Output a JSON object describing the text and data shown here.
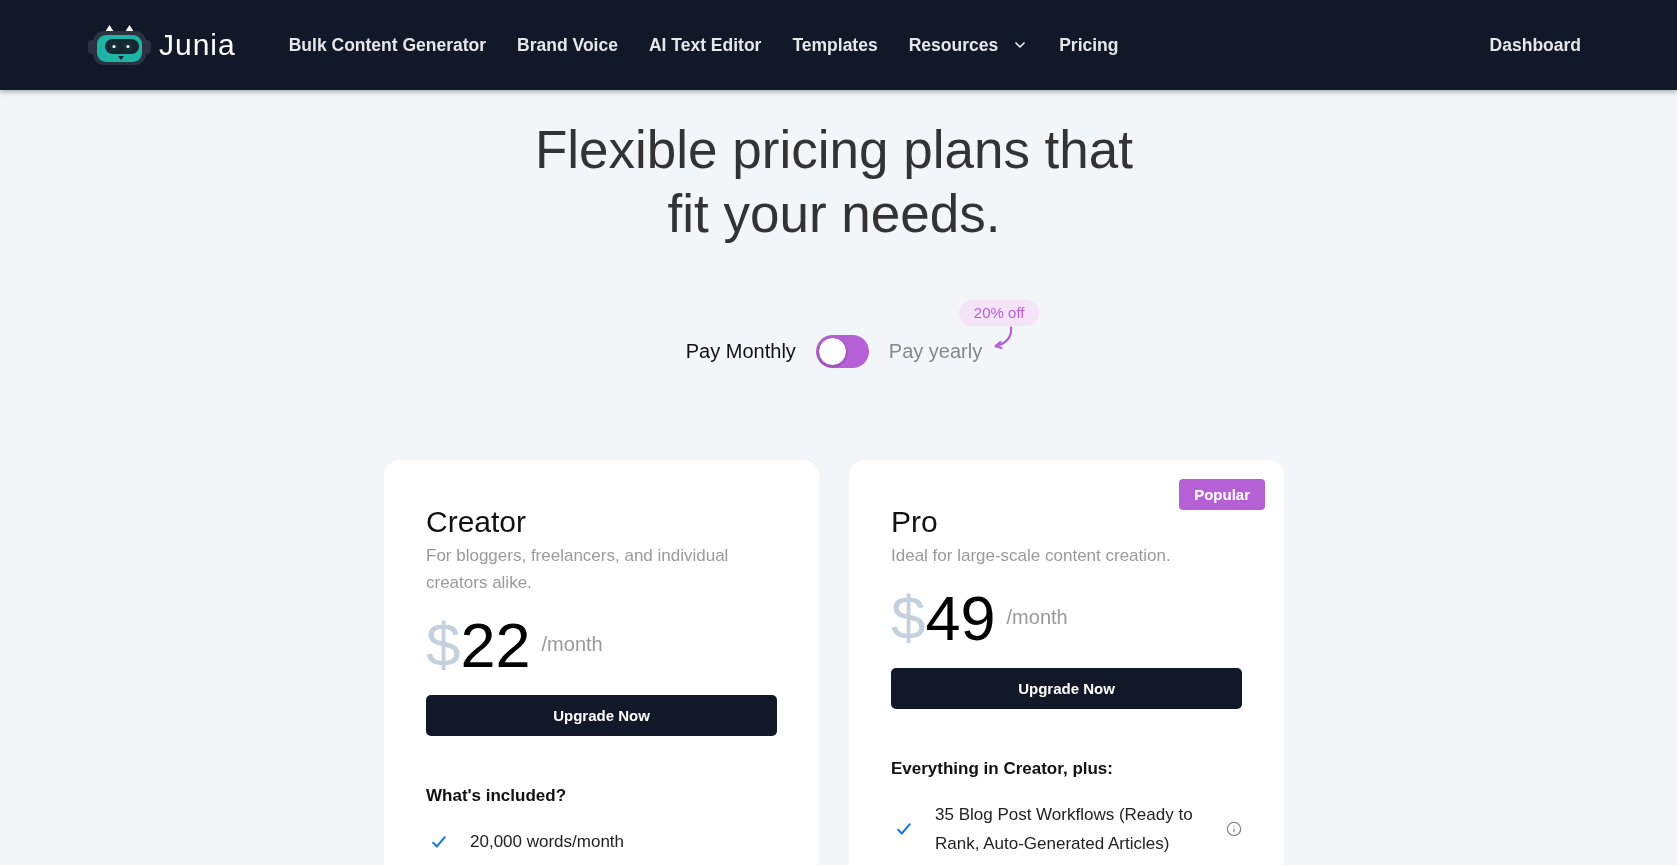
{
  "nav": {
    "logo": "Junia",
    "links": [
      {
        "label": "Bulk Content Generator",
        "kind": "link"
      },
      {
        "label": "Brand Voice",
        "kind": "link"
      },
      {
        "label": "AI Text Editor",
        "kind": "link"
      },
      {
        "label": "Templates",
        "kind": "link"
      },
      {
        "label": "Resources",
        "kind": "dropdown"
      },
      {
        "label": "Pricing",
        "kind": "link"
      }
    ],
    "account": "Dashboard"
  },
  "hero": {
    "title": "Flexible pricing plans that fit your needs."
  },
  "billing": {
    "options": [
      {
        "label": "Pay Monthly",
        "selected": true
      },
      {
        "label": "Pay yearly",
        "selected": false
      }
    ],
    "discount": "20% off"
  },
  "plans": [
    {
      "name": "Creator",
      "description": "For bloggers, freelancers, and individual creators alike.",
      "currency": "$",
      "price": "22",
      "period": "/month",
      "cta": "Upgrade Now",
      "features_heading": "What's included?",
      "features": [
        {
          "text": "20,000 words/month",
          "info": false
        }
      ]
    },
    {
      "name": "Pro",
      "badge": "Popular",
      "description": "Ideal for large-scale content creation.",
      "currency": "$",
      "price": "49",
      "period": "/month",
      "cta": "Upgrade Now",
      "features_heading": "Everything in Creator, plus:",
      "features": [
        {
          "text": "35 Blog Post Workflows (Ready to Rank, Auto-Generated Articles)",
          "info": true
        }
      ]
    }
  ]
}
